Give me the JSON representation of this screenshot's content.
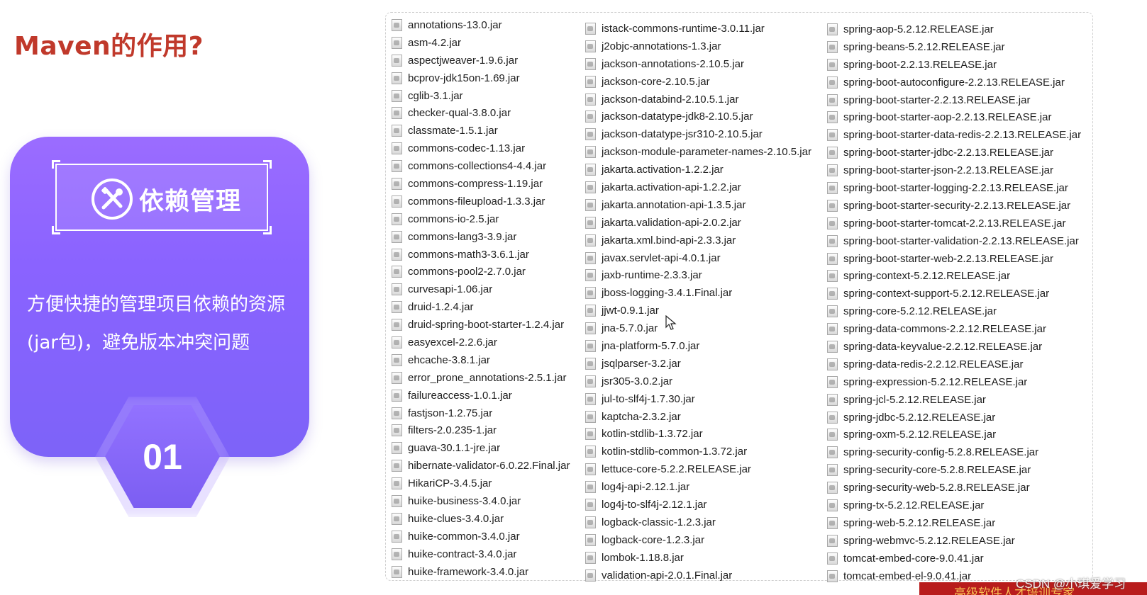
{
  "slide": {
    "title": "Maven的作用?",
    "card_label": "依赖管理",
    "card_icon": "tools-icon",
    "description": "方便快捷的管理项目依赖的资源(jar包)，避免版本冲突问题",
    "number": "01",
    "colors": {
      "title": "#c0392b",
      "card": "#8a63ff",
      "band": "#b81c1c"
    }
  },
  "files": {
    "col1": [
      "annotations-13.0.jar",
      "asm-4.2.jar",
      "aspectjweaver-1.9.6.jar",
      "bcprov-jdk15on-1.69.jar",
      "cglib-3.1.jar",
      "checker-qual-3.8.0.jar",
      "classmate-1.5.1.jar",
      "commons-codec-1.13.jar",
      "commons-collections4-4.4.jar",
      "commons-compress-1.19.jar",
      "commons-fileupload-1.3.3.jar",
      "commons-io-2.5.jar",
      "commons-lang3-3.9.jar",
      "commons-math3-3.6.1.jar",
      "commons-pool2-2.7.0.jar",
      "curvesapi-1.06.jar",
      "druid-1.2.4.jar",
      "druid-spring-boot-starter-1.2.4.jar",
      "easyexcel-2.2.6.jar",
      "ehcache-3.8.1.jar",
      "error_prone_annotations-2.5.1.jar",
      "failureaccess-1.0.1.jar",
      "fastjson-1.2.75.jar",
      "filters-2.0.235-1.jar",
      "guava-30.1.1-jre.jar",
      "hibernate-validator-6.0.22.Final.jar",
      "HikariCP-3.4.5.jar",
      "huike-business-3.4.0.jar",
      "huike-clues-3.4.0.jar",
      "huike-common-3.4.0.jar",
      "huike-contract-3.4.0.jar",
      "huike-framework-3.4.0.jar"
    ],
    "col2": [
      "istack-commons-runtime-3.0.11.jar",
      "j2objc-annotations-1.3.jar",
      "jackson-annotations-2.10.5.jar",
      "jackson-core-2.10.5.jar",
      "jackson-databind-2.10.5.1.jar",
      "jackson-datatype-jdk8-2.10.5.jar",
      "jackson-datatype-jsr310-2.10.5.jar",
      "jackson-module-parameter-names-2.10.5.jar",
      "jakarta.activation-1.2.2.jar",
      "jakarta.activation-api-1.2.2.jar",
      "jakarta.annotation-api-1.3.5.jar",
      "jakarta.validation-api-2.0.2.jar",
      "jakarta.xml.bind-api-2.3.3.jar",
      "javax.servlet-api-4.0.1.jar",
      "jaxb-runtime-2.3.3.jar",
      "jboss-logging-3.4.1.Final.jar",
      "jjwt-0.9.1.jar",
      "jna-5.7.0.jar",
      "jna-platform-5.7.0.jar",
      "jsqlparser-3.2.jar",
      "jsr305-3.0.2.jar",
      "jul-to-slf4j-1.7.30.jar",
      "kaptcha-2.3.2.jar",
      "kotlin-stdlib-1.3.72.jar",
      "kotlin-stdlib-common-1.3.72.jar",
      "lettuce-core-5.2.2.RELEASE.jar",
      "log4j-api-2.12.1.jar",
      "log4j-to-slf4j-2.12.1.jar",
      "logback-classic-1.2.3.jar",
      "logback-core-1.2.3.jar",
      "lombok-1.18.8.jar",
      "validation-api-2.0.1.Final.jar"
    ],
    "col3": [
      "spring-aop-5.2.12.RELEASE.jar",
      "spring-beans-5.2.12.RELEASE.jar",
      "spring-boot-2.2.13.RELEASE.jar",
      "spring-boot-autoconfigure-2.2.13.RELEASE.jar",
      "spring-boot-starter-2.2.13.RELEASE.jar",
      "spring-boot-starter-aop-2.2.13.RELEASE.jar",
      "spring-boot-starter-data-redis-2.2.13.RELEASE.jar",
      "spring-boot-starter-jdbc-2.2.13.RELEASE.jar",
      "spring-boot-starter-json-2.2.13.RELEASE.jar",
      "spring-boot-starter-logging-2.2.13.RELEASE.jar",
      "spring-boot-starter-security-2.2.13.RELEASE.jar",
      "spring-boot-starter-tomcat-2.2.13.RELEASE.jar",
      "spring-boot-starter-validation-2.2.13.RELEASE.jar",
      "spring-boot-starter-web-2.2.13.RELEASE.jar",
      "spring-context-5.2.12.RELEASE.jar",
      "spring-context-support-5.2.12.RELEASE.jar",
      "spring-core-5.2.12.RELEASE.jar",
      "spring-data-commons-2.2.12.RELEASE.jar",
      "spring-data-keyvalue-2.2.12.RELEASE.jar",
      "spring-data-redis-2.2.12.RELEASE.jar",
      "spring-expression-5.2.12.RELEASE.jar",
      "spring-jcl-5.2.12.RELEASE.jar",
      "spring-jdbc-5.2.12.RELEASE.jar",
      "spring-oxm-5.2.12.RELEASE.jar",
      "spring-security-config-5.2.8.RELEASE.jar",
      "spring-security-core-5.2.8.RELEASE.jar",
      "spring-security-web-5.2.8.RELEASE.jar",
      "spring-tx-5.2.12.RELEASE.jar",
      "spring-web-5.2.12.RELEASE.jar",
      "spring-webmvc-5.2.12.RELEASE.jar",
      "tomcat-embed-core-9.0.41.jar",
      "tomcat-embed-el-9.0.41.jar"
    ]
  },
  "footer": {
    "band_text": "高级软件人才培训专家",
    "watermark": "CSDN @小琪爱学习"
  }
}
